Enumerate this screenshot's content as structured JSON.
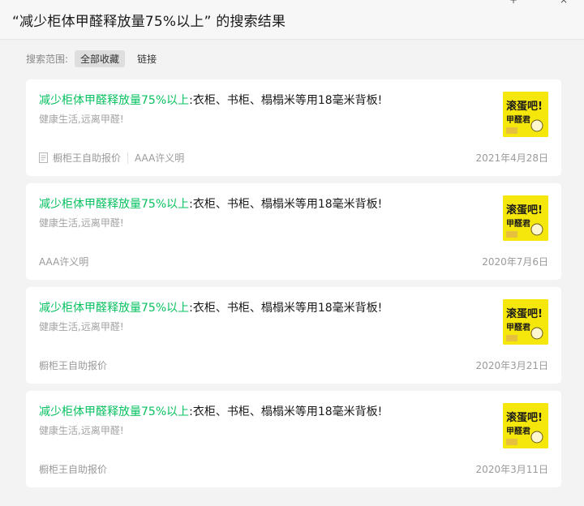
{
  "header": {
    "title": "“减少柜体甲醛释放量75%以上” 的搜索结果"
  },
  "scope": {
    "label": "搜索范围:",
    "tabs": [
      {
        "label": "全部收藏",
        "active": true
      },
      {
        "label": "链接",
        "active": false
      }
    ]
  },
  "results": [
    {
      "title_highlight": "减少柜体甲醛释放量75%以上",
      "title_rest": ":衣柜、书柜、榻榻米等用18毫米背板!",
      "desc": "健康生活,远离甲醛!",
      "source": "橱柜王自助报价",
      "author": "AAA许义明",
      "date": "2021年4月28日"
    },
    {
      "title_highlight": "减少柜体甲醛释放量75%以上",
      "title_rest": ":衣柜、书柜、榻榻米等用18毫米背板!",
      "desc": "健康生活,远离甲醛!",
      "source": "AAA许义明",
      "date": "2020年7月6日"
    },
    {
      "title_highlight": "减少柜体甲醛释放量75%以上",
      "title_rest": ":衣柜、书柜、榻榻米等用18毫米背板!",
      "desc": "健康生活,远离甲醛!",
      "source": "橱柜王自助报价",
      "date": "2020年3月21日"
    },
    {
      "title_highlight": "减少柜体甲醛释放量75%以上",
      "title_rest": ":衣柜、书柜、榻榻米等用18毫米背板!",
      "desc": "健康生活,远离甲醛!",
      "source": "橱柜王自助报价",
      "date": "2020年3月11日"
    }
  ],
  "thumbnail": {
    "text_line1": "滚蛋吧!",
    "text_line2": "甲醛君"
  },
  "colors": {
    "highlight": "#07c160",
    "thumb_bg": "#f5e60c",
    "page_bg": "#f3f3f3"
  }
}
